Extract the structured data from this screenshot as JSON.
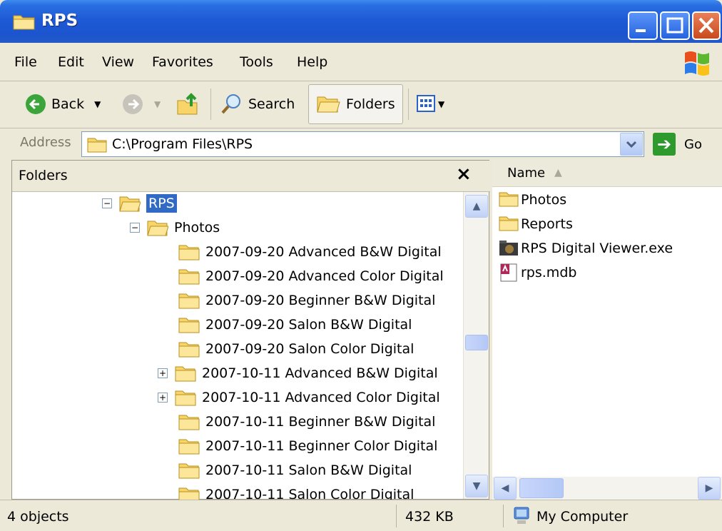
{
  "window": {
    "title": "RPS"
  },
  "menu": [
    "File",
    "Edit",
    "View",
    "Favorites",
    "Tools",
    "Help"
  ],
  "toolbar": {
    "back_label": "Back",
    "search_label": "Search",
    "folders_label": "Folders"
  },
  "address": {
    "label": "Address",
    "path": "C:\\Program Files\\RPS",
    "go_label": "Go"
  },
  "folders_pane": {
    "header": "Folders",
    "close_glyph": "×",
    "root": "RPS",
    "child": "Photos",
    "items": [
      {
        "name": "2007-09-20 Advanced B&W Digital",
        "expandable": false
      },
      {
        "name": "2007-09-20 Advanced Color Digital",
        "expandable": false
      },
      {
        "name": "2007-09-20 Beginner B&W Digital",
        "expandable": false
      },
      {
        "name": "2007-09-20 Salon B&W Digital",
        "expandable": false
      },
      {
        "name": "2007-09-20 Salon Color Digital",
        "expandable": false
      },
      {
        "name": "2007-10-11 Advanced B&W Digital",
        "expandable": true
      },
      {
        "name": "2007-10-11 Advanced Color Digital",
        "expandable": true
      },
      {
        "name": "2007-10-11 Beginner B&W Digital",
        "expandable": false
      },
      {
        "name": "2007-10-11 Beginner Color Digital",
        "expandable": false
      },
      {
        "name": "2007-10-11 Salon B&W Digital",
        "expandable": false
      },
      {
        "name": "2007-10-11 Salon Color Digital",
        "expandable": false
      }
    ]
  },
  "file_list": {
    "column_name": "Name",
    "files": [
      {
        "name": "Photos",
        "icon": "folder-icon"
      },
      {
        "name": "Reports",
        "icon": "folder-icon"
      },
      {
        "name": "RPS Digital Viewer.exe",
        "icon": "exe-icon"
      },
      {
        "name": "rps.mdb",
        "icon": "access-db-icon"
      }
    ]
  },
  "status": {
    "objects": "4 objects",
    "size": "432 KB",
    "zone": "My Computer"
  }
}
